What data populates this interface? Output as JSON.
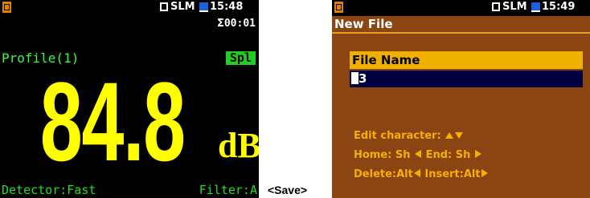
{
  "left_screen": {
    "status": {
      "mode": "SLM",
      "time": "15:48"
    },
    "timer": "00:01",
    "profile": "Profile(1)",
    "badge": "Spl",
    "reading": {
      "value": "84.8",
      "unit": "dB"
    },
    "detector": "Detector:Fast",
    "filter": "Filter:A"
  },
  "caption": "<Save>",
  "right_screen": {
    "status": {
      "mode": "SLM",
      "time": "15:49"
    },
    "title": "New File",
    "field_label": "File Name",
    "field_value": "3",
    "help": {
      "edit": "Edit character:",
      "home": "Home: Sh",
      "end": "End: Sh",
      "delete": "Delete:Alt",
      "insert": "Insert:Alt"
    }
  },
  "colors": {
    "reading": "#ffff00",
    "status_green": "#22dd22",
    "menu_bg": "#8b4513",
    "field_highlight": "#f0b000",
    "help_text": "#f5b000"
  },
  "icons": [
    "file-icon",
    "mode-box-icon",
    "memory-icon",
    "sigma-icon",
    "arrow-up-icon",
    "arrow-down-icon",
    "arrow-left-icon",
    "arrow-right-icon"
  ]
}
